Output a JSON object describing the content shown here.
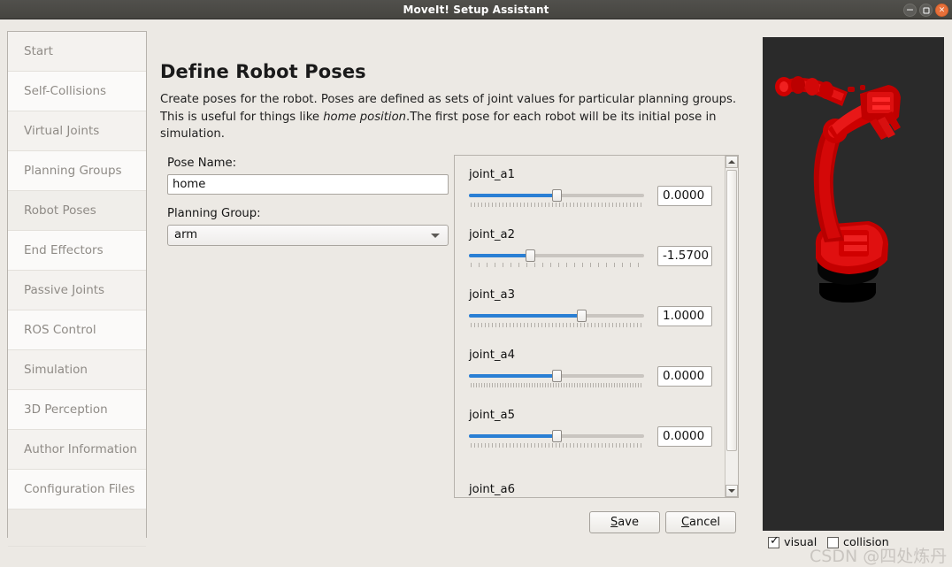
{
  "window": {
    "title": "MoveIt! Setup Assistant",
    "controls": {
      "minimize": "minimize-button",
      "maximize": "maximize-button",
      "close": "close-button",
      "close_glyph": "×",
      "minimize_glyph": "−"
    }
  },
  "sidebar": {
    "items": [
      {
        "label": "Start"
      },
      {
        "label": "Self-Collisions"
      },
      {
        "label": "Virtual Joints"
      },
      {
        "label": "Planning Groups"
      },
      {
        "label": "Robot Poses"
      },
      {
        "label": "End Effectors"
      },
      {
        "label": "Passive Joints"
      },
      {
        "label": "ROS Control"
      },
      {
        "label": "Simulation"
      },
      {
        "label": "3D Perception"
      },
      {
        "label": "Author Information"
      },
      {
        "label": "Configuration Files"
      }
    ],
    "selected_index": 4
  },
  "content": {
    "title": "Define Robot Poses",
    "description_part1": "Create poses for the robot. Poses are defined as sets of joint values for particular planning groups. This is useful for things like ",
    "description_emphasis": "home position",
    "description_part2": ".The first pose for each robot will be its initial pose in simulation."
  },
  "form": {
    "pose_name_label": "Pose Name:",
    "pose_name_value": "home",
    "pose_name_placeholder": "",
    "planning_group_label": "Planning Group:",
    "planning_group_value": "arm",
    "planning_group_options": [
      "arm"
    ]
  },
  "joints": {
    "rows": [
      {
        "name": "joint_a1",
        "value": "0.0000",
        "percent": 50
      },
      {
        "name": "joint_a2",
        "value": "-1.5700",
        "percent": 35
      },
      {
        "name": "joint_a3",
        "value": "1.0000",
        "percent": 64
      },
      {
        "name": "joint_a4",
        "value": "0.0000",
        "percent": 50
      },
      {
        "name": "joint_a5",
        "value": "0.0000",
        "percent": 50
      }
    ],
    "clipped_next": "joint_a6",
    "scroll_up_arrow": "scroll-up-arrow",
    "scroll_down_arrow": "scroll-down-arrow"
  },
  "actions": {
    "save_mnemonic": "S",
    "save_rest": "ave",
    "cancel_mnemonic": "C",
    "cancel_rest": "ancel"
  },
  "render_options": {
    "visual_label": "visual",
    "visual_checked": true,
    "collision_label": "collision",
    "collision_checked": false,
    "check_glyph": "✓"
  },
  "watermark": {
    "text": "CSDN @四处炼丹"
  },
  "colors": {
    "accent_blue": "#2a7fd4",
    "robot_red": "#d00000",
    "viewport_bg": "#2a2a2a",
    "window_bg": "#ece9e4",
    "close_button": "#e8703a"
  }
}
